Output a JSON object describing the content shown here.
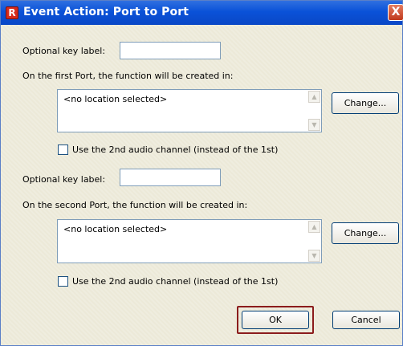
{
  "window": {
    "title": "Event Action: Port to Port",
    "app_icon": "R",
    "close_glyph": "X"
  },
  "port1": {
    "key_label": "Optional key label:",
    "key_value": "",
    "location_label": "On the first Port, the function will be created in:",
    "location_text": "<no location selected>",
    "change_label": "Change...",
    "checkbox_label": "Use the 2nd audio channel (instead of the 1st)",
    "checked": false
  },
  "port2": {
    "key_label": "Optional key label:",
    "key_value": "",
    "location_label": "On the second Port, the function will be created in:",
    "location_text": "<no location selected>",
    "change_label": "Change...",
    "checkbox_label": "Use the 2nd audio channel (instead of the 1st)",
    "checked": false
  },
  "footer": {
    "ok_label": "OK",
    "cancel_label": "Cancel"
  }
}
